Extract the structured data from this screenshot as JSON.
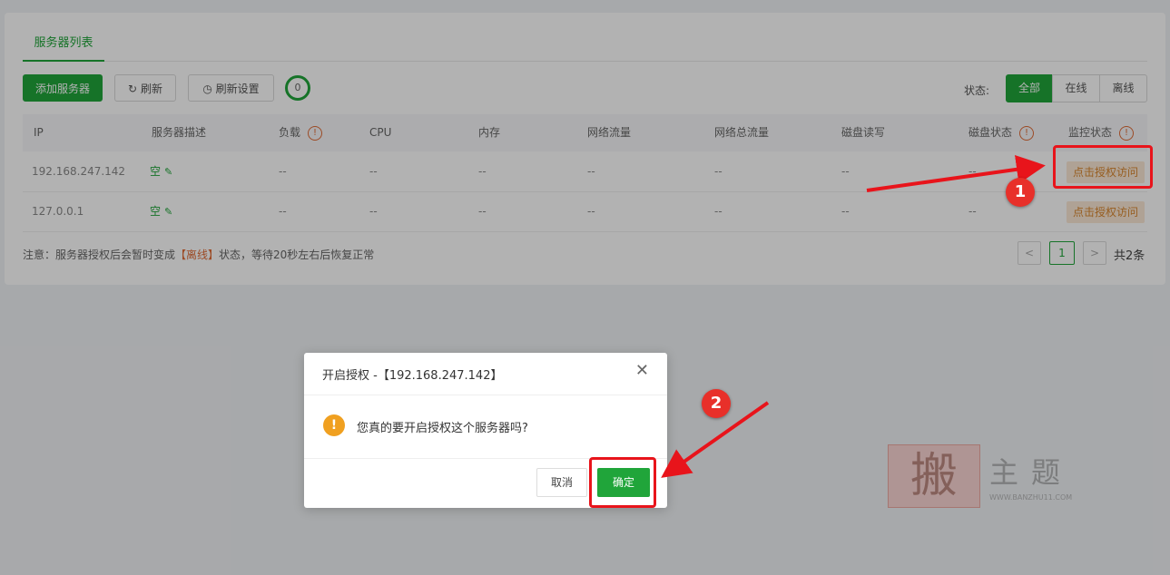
{
  "tab": {
    "label": "服务器列表"
  },
  "toolbar": {
    "add_label": "添加服务器",
    "refresh_label": "刷新",
    "refresh_settings_label": "刷新设置",
    "counter": "0"
  },
  "status_filter": {
    "label": "状态:",
    "options": [
      "全部",
      "在线",
      "离线"
    ],
    "selected": "全部"
  },
  "table": {
    "headers": [
      "IP",
      "服务器描述",
      "负载",
      "CPU",
      "内存",
      "网络流量",
      "网络总流量",
      "磁盘读写",
      "磁盘状态",
      "监控状态"
    ],
    "rows": [
      {
        "ip": "192.168.247.142",
        "desc": "空",
        "load": "--",
        "cpu": "--",
        "mem": "--",
        "net": "--",
        "net_total": "--",
        "disk_io": "--",
        "disk_status": "--",
        "action": "点击授权访问"
      },
      {
        "ip": "127.0.0.1",
        "desc": "空",
        "load": "--",
        "cpu": "--",
        "mem": "--",
        "net": "--",
        "net_total": "--",
        "disk_io": "--",
        "disk_status": "--",
        "action": "点击授权访问"
      }
    ]
  },
  "note": {
    "prefix": "注意：服务器授权后会暂时变成",
    "highlight": "【离线】",
    "suffix": "状态，等待20秒左右后恢复正常"
  },
  "pager": {
    "prev": "<",
    "current": "1",
    "next": ">",
    "total": "共2条"
  },
  "dialog": {
    "title": "开启授权 -【192.168.247.142】",
    "message": "您真的要开启授权这个服务器吗?",
    "cancel_label": "取消",
    "ok_label": "确定"
  },
  "annotations": {
    "step1": "1",
    "step2": "2"
  },
  "watermark": {
    "seal": "搬",
    "text": "主题",
    "url": "WWW.BANZHU11.COM"
  },
  "colors": {
    "accent": "#20a53a",
    "warning": "#e06c37",
    "annotation": "#e8141b"
  }
}
